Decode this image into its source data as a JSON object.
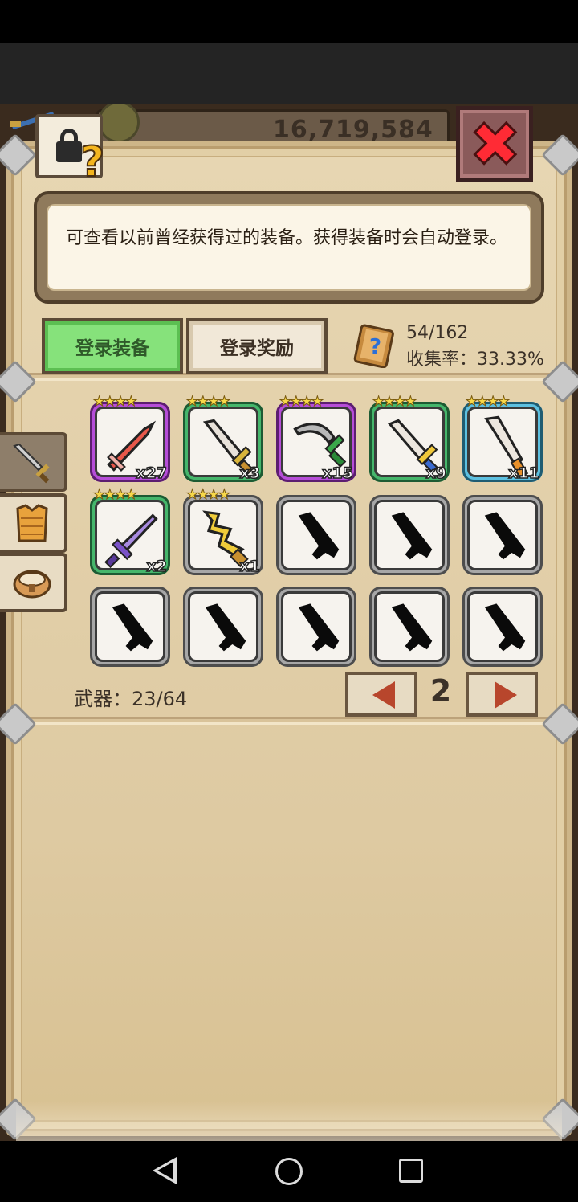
{
  "hud": {
    "money": "16,719,584"
  },
  "description": "可查看以前曾经获得过的装备。获得装备时会自动登录。",
  "tabs": {
    "registered_label": "登录装备",
    "rewards_label": "登录奖励"
  },
  "collection": {
    "count": "54/162",
    "rate": "收集率：33.33%"
  },
  "categories": [
    {
      "name": "weapon-icon",
      "selected": true
    },
    {
      "name": "armor-icon",
      "selected": false
    },
    {
      "name": "accessory-icon",
      "selected": false
    }
  ],
  "items": [
    {
      "icon": "red-sword-icon",
      "frame": "purple",
      "stars": "★★★★",
      "qty": "x27"
    },
    {
      "icon": "broad-sword-icon",
      "frame": "green",
      "stars": "★★★★",
      "qty": "x3"
    },
    {
      "icon": "scimitar-icon",
      "frame": "purple",
      "stars": "★★★★",
      "qty": "x15"
    },
    {
      "icon": "gold-hilt-sword-icon",
      "frame": "green",
      "stars": "★★★★",
      "qty": "x9"
    },
    {
      "icon": "machete-icon",
      "frame": "blue",
      "stars": "★★★★",
      "qty": "x11"
    },
    {
      "icon": "purple-sword-icon",
      "frame": "green",
      "stars": "★★★★",
      "qty": "x2"
    },
    {
      "icon": "lightning-sword-icon",
      "frame": "gray",
      "stars": "★★★★",
      "qty": "x1"
    },
    {
      "icon": "locked-weapon-icon",
      "frame": "gray",
      "stars": "",
      "qty": ""
    },
    {
      "icon": "locked-weapon-icon",
      "frame": "gray",
      "stars": "",
      "qty": ""
    },
    {
      "icon": "locked-weapon-icon",
      "frame": "gray",
      "stars": "",
      "qty": ""
    },
    {
      "icon": "locked-weapon-icon",
      "frame": "gray",
      "stars": "",
      "qty": ""
    },
    {
      "icon": "locked-weapon-icon",
      "frame": "gray",
      "stars": "",
      "qty": ""
    },
    {
      "icon": "locked-weapon-icon",
      "frame": "gray",
      "stars": "",
      "qty": ""
    },
    {
      "icon": "locked-weapon-icon",
      "frame": "gray",
      "stars": "",
      "qty": ""
    },
    {
      "icon": "locked-weapon-icon",
      "frame": "gray",
      "stars": "",
      "qty": ""
    }
  ],
  "footer": {
    "weapon_count": "武器：23/64",
    "page": "2"
  },
  "colors": {
    "selected_tab": "#86e27b",
    "panel": "#e2cfa6",
    "close_red": "#ff2b35",
    "page_arrow": "#b8462c"
  }
}
